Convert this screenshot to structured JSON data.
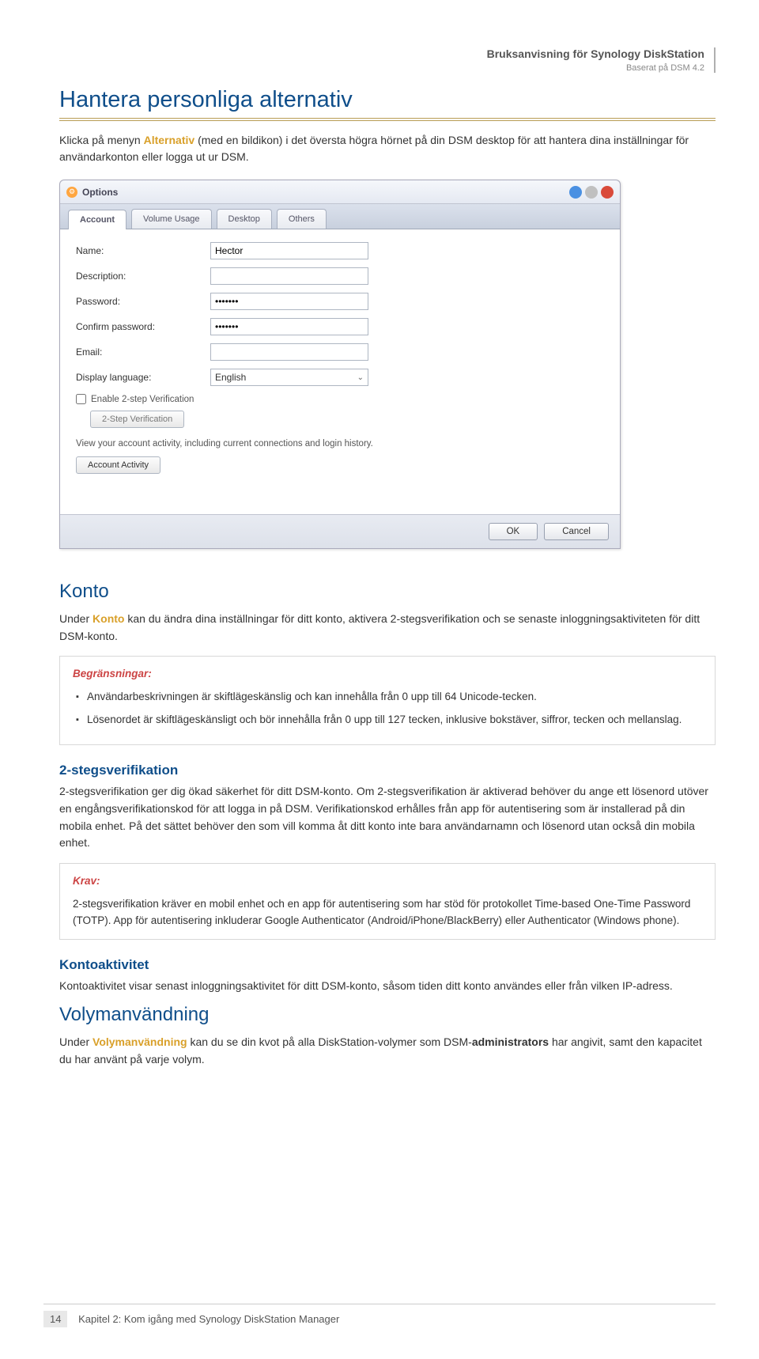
{
  "header": {
    "line1": "Bruksanvisning för Synology DiskStation",
    "line2": "Baserat på DSM 4.2"
  },
  "h1": "Hantera personliga alternativ",
  "intro_pre": "Klicka på menyn ",
  "intro_kw": "Alternativ",
  "intro_post": " (med en bildikon) i det översta högra hörnet på din DSM desktop för att hantera dina inställningar för användarkonton eller logga ut ur DSM.",
  "window": {
    "title": "Options",
    "tabs": [
      "Account",
      "Volume Usage",
      "Desktop",
      "Others"
    ],
    "fields": {
      "name_label": "Name:",
      "name_value": "Hector",
      "desc_label": "Description:",
      "pass_label": "Password:",
      "pass_value": "•••••••",
      "cpass_label": "Confirm password:",
      "cpass_value": "•••••••",
      "email_label": "Email:",
      "lang_label": "Display language:",
      "lang_value": "English"
    },
    "enable_2step": "Enable 2-step Verification",
    "twostep_btn": "2-Step Verification",
    "activity_note": "View your account activity, including current connections and login history.",
    "activity_btn": "Account Activity",
    "ok": "OK",
    "cancel": "Cancel"
  },
  "konto": {
    "h2": "Konto",
    "para_pre": "Under ",
    "para_kw": "Konto",
    "para_post": " kan du ändra dina inställningar för ditt konto, aktivera 2-stegsverifikation och se senaste inloggningsaktiviteten för ditt DSM-konto.",
    "box_title": "Begränsningar:",
    "li1": "Användarbeskrivningen är skiftlägeskänslig och kan innehålla från 0 upp till 64 Unicode-tecken.",
    "li2": "Lösenordet är skiftlägeskänsligt och bör innehålla från 0 upp till 127 tecken, inklusive bokstäver, siffror, tecken och mellanslag."
  },
  "twostep": {
    "h3": "2-stegsverifikation",
    "para": "2-stegsverifikation ger dig ökad säkerhet för ditt DSM-konto. Om 2-stegsverifikation är aktiverad behöver du ange ett lösenord utöver en engångsverifikationskod för att logga in på DSM. Verifikationskod erhålles från app för autentisering som är installerad på din mobila enhet. På det sättet behöver den som vill komma åt ditt konto inte bara användarnamn och lösenord utan också din mobila enhet.",
    "box_title": "Krav:",
    "box_text": "2-stegsverifikation kräver en mobil enhet och en app för autentisering som har stöd för protokollet Time-based One-Time Password (TOTP). App för autentisering inkluderar Google Authenticator (Android/iPhone/BlackBerry) eller Authenticator (Windows phone)."
  },
  "kontoaktivitet": {
    "h3": "Kontoaktivitet",
    "para": "Kontoaktivitet visar senast inloggningsaktivitet för ditt DSM-konto, såsom tiden ditt konto användes eller från vilken IP-adress."
  },
  "volym": {
    "h2": "Volymanvändning",
    "para_pre": "Under ",
    "para_kw": "Volymanvändning",
    "para_post1": " kan du se din kvot på alla DiskStation-volymer som DSM-",
    "para_bold": "administrators",
    "para_post2": " har angivit, samt den kapacitet du har använt på varje volym."
  },
  "footer": {
    "page": "14",
    "text": "Kapitel 2: Kom igång med Synology DiskStation Manager"
  }
}
